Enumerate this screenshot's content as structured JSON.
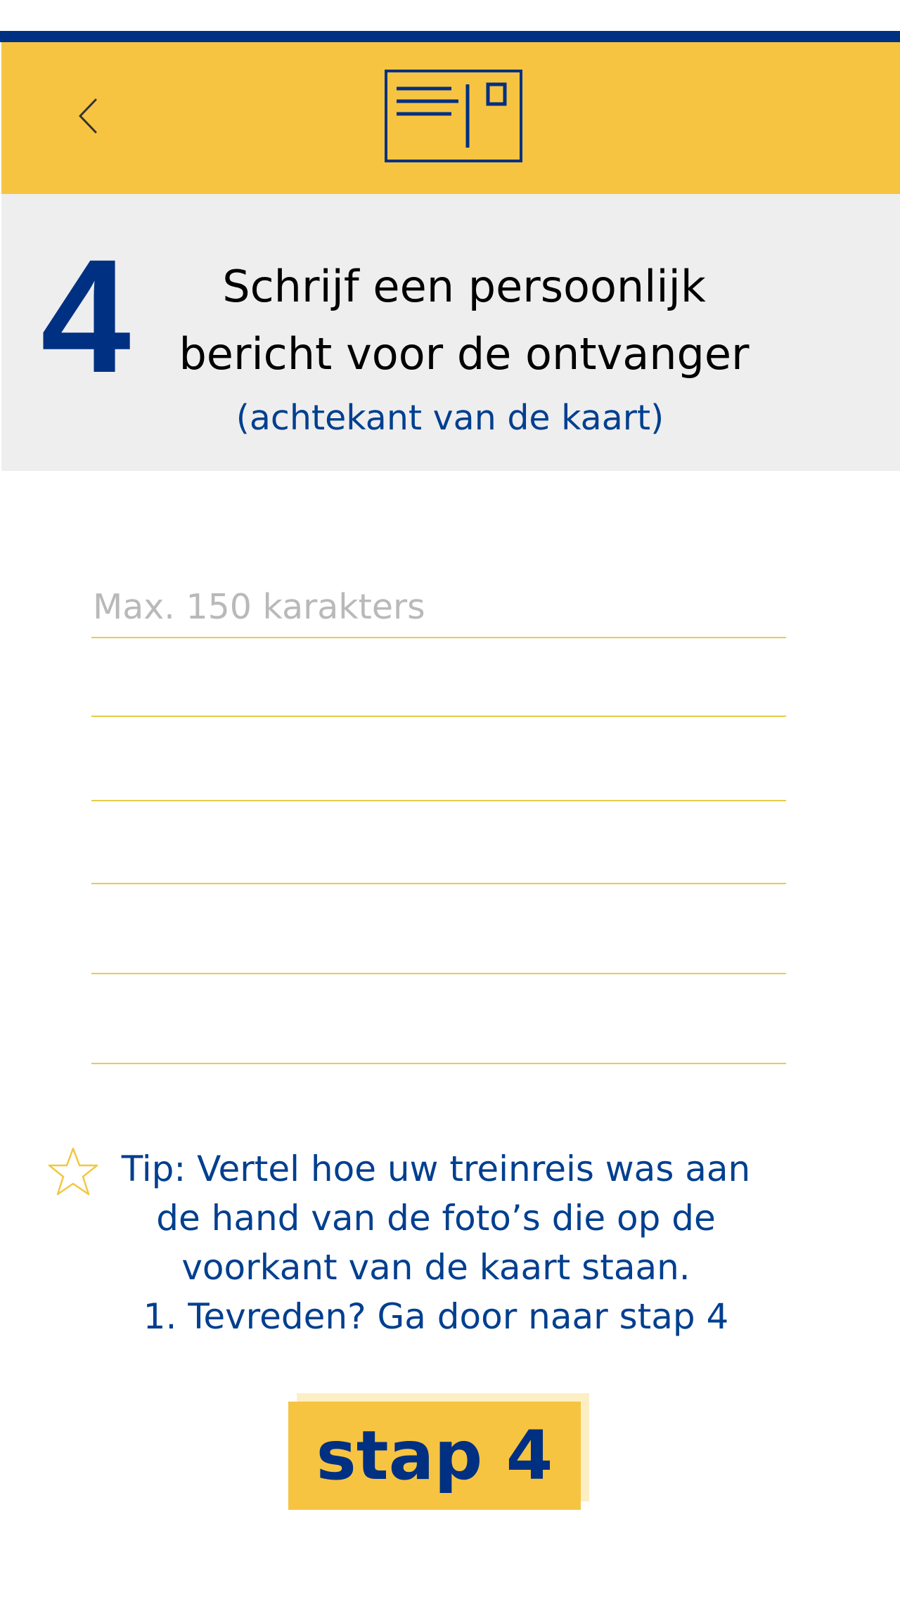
{
  "header": {
    "back_icon": "chevron-left-icon",
    "logo_icon": "postcard-icon",
    "accent_color": "#f7c442",
    "brand_color": "#003082"
  },
  "step": {
    "number": "4",
    "title_line1": "Schrijf een persoonlijk",
    "title_line2": "bericht voor de ontvanger",
    "subtitle": "(achtekant van de kaart)"
  },
  "message": {
    "placeholder": "Max. 150 karakters",
    "value": ""
  },
  "tip": {
    "icon": "star-icon",
    "lines": [
      "Tip: Vertel hoe uw treinreis was aan",
      "de hand van de foto’s die op de",
      "voorkant van de kaart staan.",
      "1. Tevreden? Ga door naar stap 4"
    ]
  },
  "next_button": {
    "label": "stap 4"
  }
}
